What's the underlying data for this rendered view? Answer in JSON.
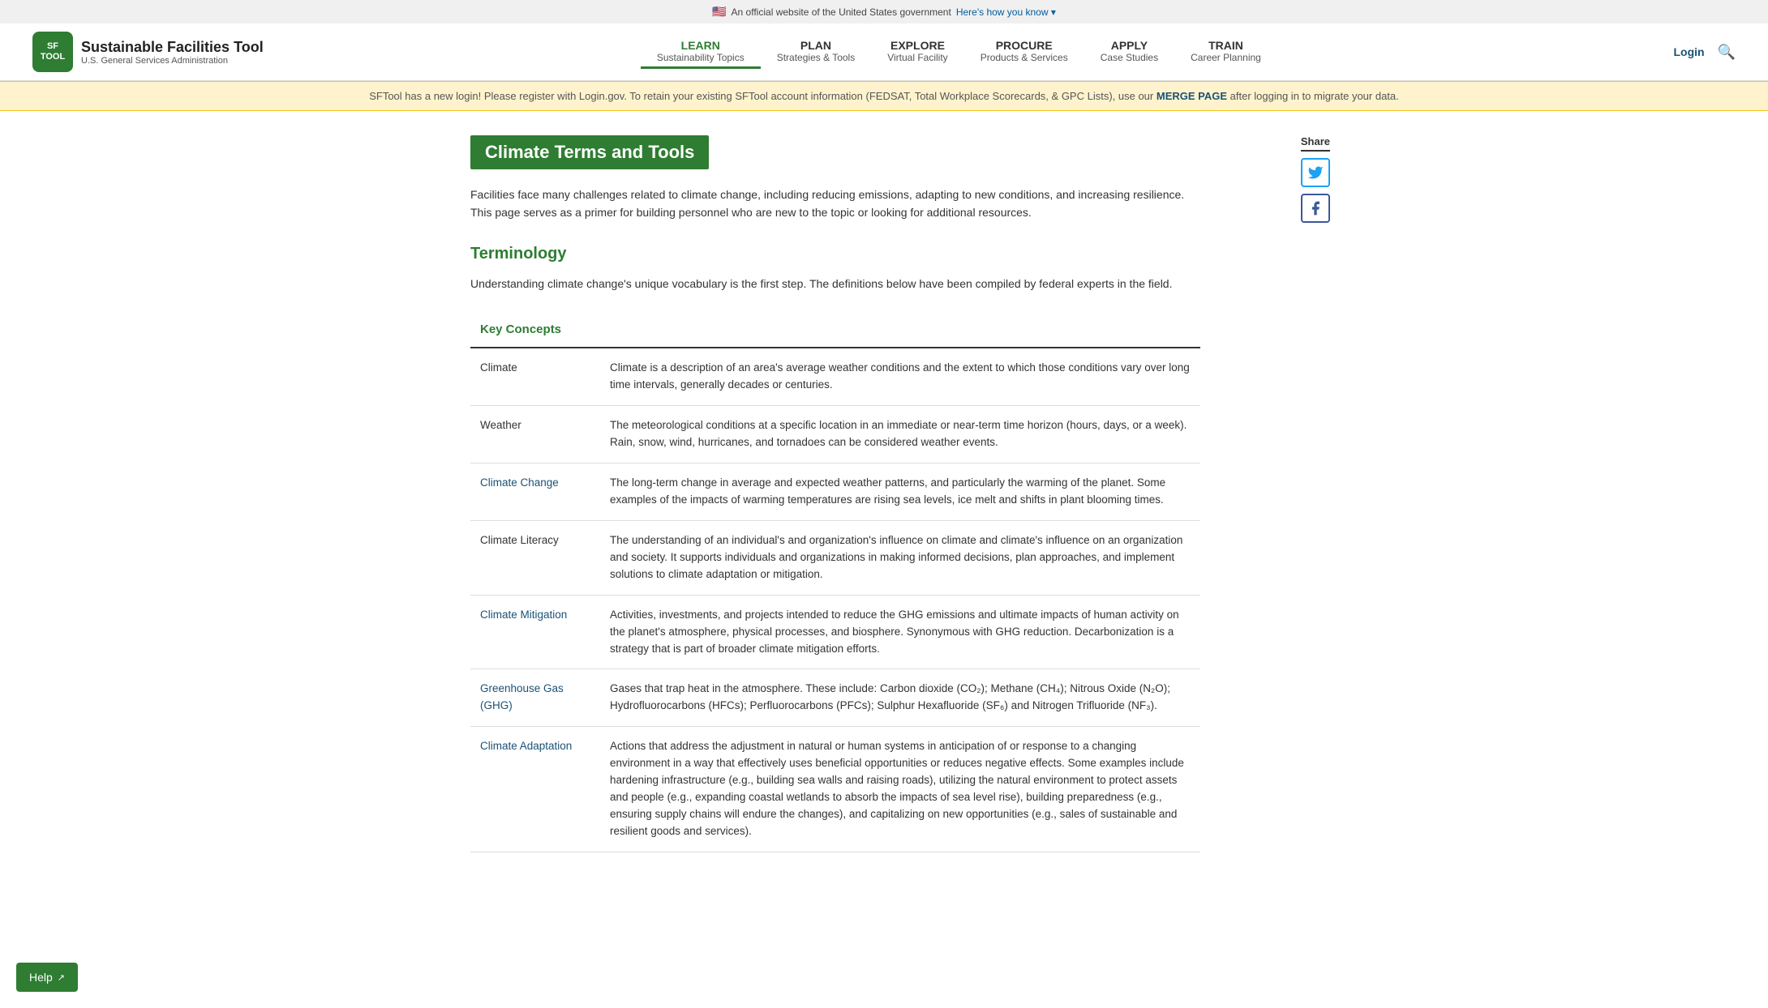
{
  "gov_banner": {
    "flag": "🇺🇸",
    "text": "An official website of the United States government",
    "link_text": "Here's how you know",
    "link_arrow": "▾"
  },
  "header": {
    "logo_line1": "SF",
    "logo_line2": "TOOL",
    "site_name": "Sustainable Facilities Tool",
    "site_sub": "U.S. General Services Administration",
    "login_label": "Login",
    "nav": [
      {
        "id": "learn",
        "label": "LEARN",
        "sub": "Sustainability Topics",
        "active": true
      },
      {
        "id": "plan",
        "label": "PLAN",
        "sub": "Strategies & Tools",
        "active": false
      },
      {
        "id": "explore",
        "label": "EXPLORE",
        "sub": "Virtual Facility",
        "active": false
      },
      {
        "id": "procure",
        "label": "PROCURE",
        "sub": "Products & Services",
        "active": false
      },
      {
        "id": "apply",
        "label": "APPLY",
        "sub": "Case Studies",
        "active": false
      },
      {
        "id": "train",
        "label": "TRAIN",
        "sub": "Career Planning",
        "active": false
      }
    ]
  },
  "alert": {
    "text_before": "SFTool has a new login! Please register with Login.gov. To retain your existing SFTool account information (FEDSAT, Total Workplace Scorecards, & GPC Lists), use our ",
    "link_text": "MERGE PAGE",
    "text_after": " after logging in to migrate your data."
  },
  "share": {
    "label": "Share"
  },
  "page": {
    "title": "Climate Terms and Tools",
    "intro": "Facilities face many challenges related to climate change, including reducing emissions, adapting to new conditions, and increasing resilience. This page serves as a primer for building personnel who are new to the topic or looking for additional resources.",
    "section_title": "Terminology",
    "terminology_intro": "Understanding climate change's unique vocabulary is the first step. The definitions below have been compiled by federal experts in the field.",
    "table_header": "Key Concepts",
    "terms": [
      {
        "term": "Climate",
        "linked": false,
        "definition": "Climate is a description of an area's average weather conditions and the extent to which those conditions vary over long time intervals, generally decades or centuries."
      },
      {
        "term": "Weather",
        "linked": false,
        "definition": "The meteorological conditions at a specific location in an immediate or near-term time horizon (hours, days, or a week). Rain, snow, wind, hurricanes, and tornadoes can be considered weather events."
      },
      {
        "term": "Climate Change",
        "linked": true,
        "definition": "The long-term change in average and expected weather patterns, and particularly the warming of the planet. Some examples of the impacts of warming temperatures are rising sea levels, ice melt and shifts in plant blooming times."
      },
      {
        "term": "Climate Literacy",
        "linked": false,
        "definition": "The understanding of an individual's and organization's influence on climate and climate's influence on an organization and society. It supports individuals and organizations in making informed decisions, plan approaches, and implement solutions to climate adaptation or mitigation."
      },
      {
        "term": "Climate Mitigation",
        "linked": true,
        "definition": "Activities, investments, and projects intended to reduce the GHG emissions and ultimate impacts of human activity on the planet's atmosphere, physical processes, and biosphere. Synonymous with GHG reduction. Decarbonization is a strategy that is part of broader climate mitigation efforts."
      },
      {
        "term": "Greenhouse Gas (GHG)",
        "linked": true,
        "definition": "Gases that trap heat in the atmosphere. These include: Carbon dioxide (CO₂); Methane (CH₄); Nitrous Oxide (N₂O); Hydrofluorocarbons (HFCs); Perfluorocarbons (PFCs); Sulphur Hexafluoride (SF₆) and Nitrogen Trifluoride (NF₃)."
      },
      {
        "term": "Climate Adaptation",
        "linked": true,
        "definition": "Actions that address the adjustment in natural or human systems in anticipation of or response to a changing environment in a way that effectively uses beneficial opportunities or reduces negative effects. Some examples include hardening infrastructure (e.g., building sea walls and raising roads), utilizing the natural environment to protect assets and people (e.g., expanding coastal wetlands to absorb the impacts of sea level rise), building preparedness (e.g., ensuring supply chains will endure the changes), and capitalizing on new opportunities (e.g., sales of sustainable and resilient goods and services)."
      }
    ]
  },
  "help_button": {
    "label": "Help",
    "icon": "↗"
  }
}
